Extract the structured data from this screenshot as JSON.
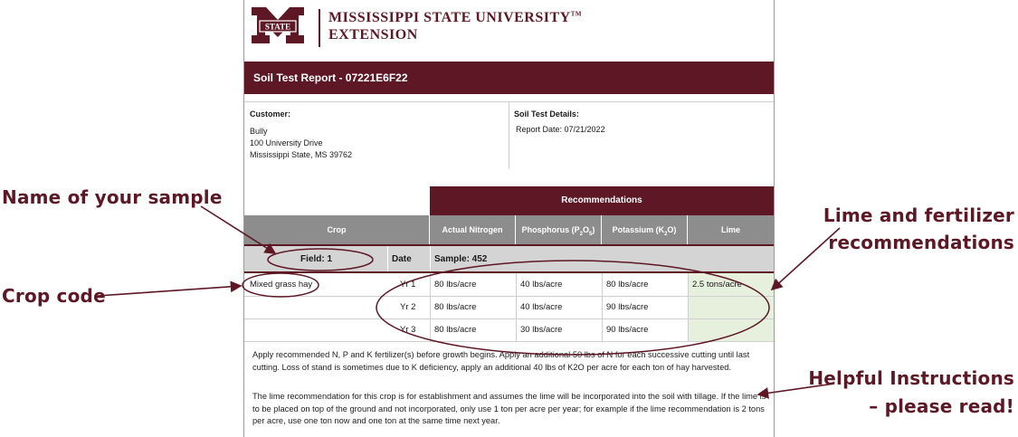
{
  "header": {
    "university": "MISSISSIPPI STATE UNIVERSITY",
    "trademark": "TM",
    "extension": "EXTENSION",
    "logo_text": "STATE"
  },
  "report": {
    "title": "Soil Test Report - 07221E6F22",
    "customer_label": "Customer:",
    "customer_name": "Bully",
    "customer_address1": "100 University Drive",
    "customer_address2": "Mississippi State, MS 39762",
    "details_label": "Soil Test Details:",
    "report_date": "Report Date: 07/21/2022"
  },
  "table": {
    "recommendations_label": "Recommendations",
    "columns": {
      "crop": "Crop",
      "nitrogen": "Actual Nitrogen",
      "phosphorus": "Phosphorus (P",
      "phosphorus_sub1": "2",
      "phosphorus_mid": "O",
      "phosphorus_sub2": "5",
      "phosphorus_end": ")",
      "potassium": "Potassium (K",
      "potassium_sub": "2",
      "potassium_end": "O)",
      "lime": "Lime"
    },
    "field": "Field: 1",
    "date_label": "Date",
    "sample": "Sample: 452",
    "crop_name": "Mixed grass hay",
    "rows": [
      {
        "year": "Yr 1",
        "n": "80 lbs/acre",
        "p": "40 lbs/acre",
        "k": "80 lbs/acre",
        "lime": "2.5 tons/acre"
      },
      {
        "year": "Yr 2",
        "n": "80 lbs/acre",
        "p": "40 lbs/acre",
        "k": "90 lbs/acre",
        "lime": ""
      },
      {
        "year": "Yr 3",
        "n": "80 lbs/acre",
        "p": "30 lbs/acre",
        "k": "90 lbs/acre",
        "lime": ""
      }
    ]
  },
  "instructions": {
    "para1": "Apply recommended N, P and K fertilizer(s) before growth begins. Apply an additional 50 lbs of N for each successive cutting until last cutting. Loss of stand is sometimes due to K deficiency, apply an additional 40 lbs of K2O per acre for each ton of hay harvested.",
    "para2": "The lime recommendation for this crop is for establishment and assumes the lime will be incorporated into the soil with tillage. If the lime is to be placed on top of the ground and not incorporated, only use 1 ton per acre per year; for example if the lime recommendation is 2 tons per acre, use one ton now and one ton at the same time next year."
  },
  "annotations": {
    "sample_name": "Name of your sample",
    "crop_code": "Crop code",
    "lime_fert_line1": "Lime and fertilizer",
    "lime_fert_line2": "recommendations",
    "helpful_line1": "Helpful Instructions",
    "helpful_line2": "– please read!"
  },
  "colors": {
    "maroon": "#5d1725",
    "header_gray": "#8d8d8d",
    "field_gray": "#d4d4d4",
    "lime_green": "#e6f0dc"
  }
}
